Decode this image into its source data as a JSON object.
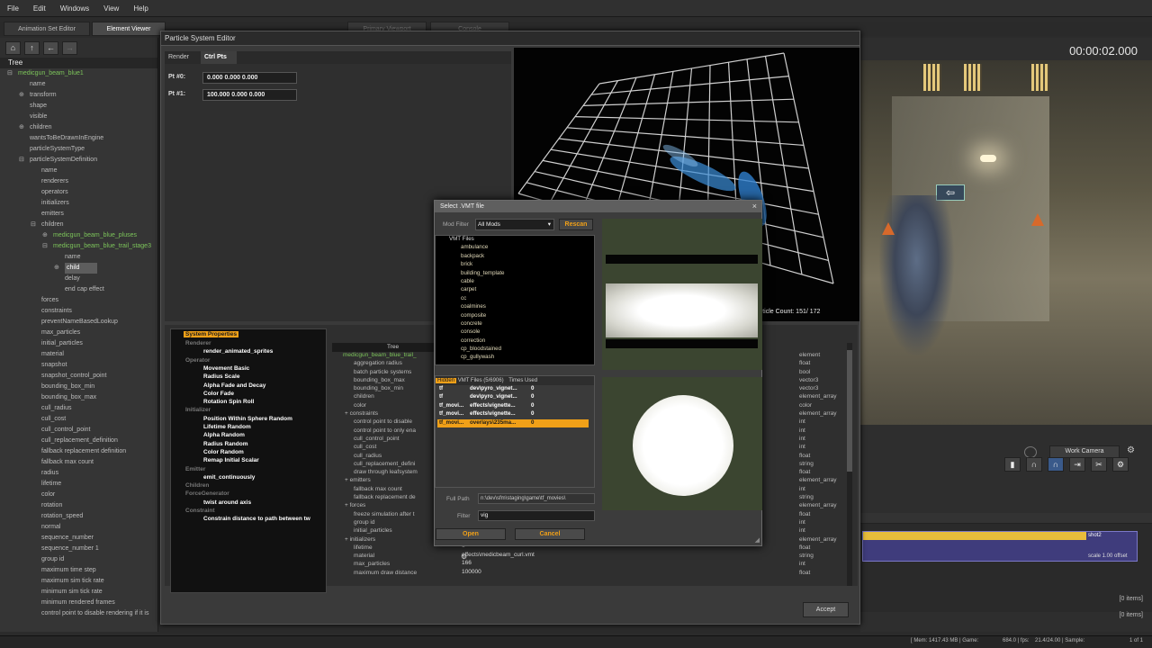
{
  "menu": [
    "File",
    "Edit",
    "Windows",
    "View",
    "Help"
  ],
  "top_tabs": {
    "animation_set_editor": "Animation Set Editor",
    "element_viewer": "Element Viewer",
    "primary_viewport": "Primary Viewport",
    "console": "Console"
  },
  "tree": {
    "header": "Tree",
    "items": [
      {
        "label": "medicgun_beam_blue1",
        "indent": 0,
        "green": true,
        "exp": "-"
      },
      {
        "label": "name",
        "indent": 1
      },
      {
        "label": "transform",
        "indent": 1,
        "exp": "+"
      },
      {
        "label": "shape",
        "indent": 1
      },
      {
        "label": "visible",
        "indent": 1
      },
      {
        "label": "children",
        "indent": 1,
        "exp": "+"
      },
      {
        "label": "wantsToBeDrawnInEngine",
        "indent": 1
      },
      {
        "label": "particleSystemType",
        "indent": 1
      },
      {
        "label": "particleSystemDefinition",
        "indent": 1,
        "exp": "-"
      },
      {
        "label": "name",
        "indent": 2
      },
      {
        "label": "renderers",
        "indent": 2
      },
      {
        "label": "operators",
        "indent": 2
      },
      {
        "label": "initializers",
        "indent": 2
      },
      {
        "label": "emitters",
        "indent": 2
      },
      {
        "label": "children",
        "indent": 2,
        "exp": "-"
      },
      {
        "label": "medicgun_beam_blue_pluses",
        "indent": 3,
        "green": true,
        "exp": "+"
      },
      {
        "label": "medicgun_beam_blue_trail_stage3",
        "indent": 3,
        "green": true,
        "exp": "-"
      },
      {
        "label": "name",
        "indent": 4
      },
      {
        "label": "child",
        "indent": 4,
        "sel": true,
        "exp": "+"
      },
      {
        "label": "delay",
        "indent": 4
      },
      {
        "label": "end cap effect",
        "indent": 4
      },
      {
        "label": "forces",
        "indent": 2
      },
      {
        "label": "constraints",
        "indent": 2
      },
      {
        "label": "preventNameBasedLookup",
        "indent": 2
      },
      {
        "label": "max_particles",
        "indent": 2
      },
      {
        "label": "initial_particles",
        "indent": 2
      },
      {
        "label": "material",
        "indent": 2
      },
      {
        "label": "snapshot",
        "indent": 2
      },
      {
        "label": "snapshot_control_point",
        "indent": 2
      },
      {
        "label": "bounding_box_min",
        "indent": 2
      },
      {
        "label": "bounding_box_max",
        "indent": 2
      },
      {
        "label": "cull_radius",
        "indent": 2
      },
      {
        "label": "cull_cost",
        "indent": 2
      },
      {
        "label": "cull_control_point",
        "indent": 2
      },
      {
        "label": "cull_replacement_definition",
        "indent": 2
      },
      {
        "label": "fallback replacement definition",
        "indent": 2
      },
      {
        "label": "fallback max count",
        "indent": 2
      },
      {
        "label": "radius",
        "indent": 2
      },
      {
        "label": "lifetime",
        "indent": 2
      },
      {
        "label": "color",
        "indent": 2
      },
      {
        "label": "rotation",
        "indent": 2
      },
      {
        "label": "rotation_speed",
        "indent": 2
      },
      {
        "label": "normal",
        "indent": 2
      },
      {
        "label": "sequence_number",
        "indent": 2
      },
      {
        "label": "sequence_number 1",
        "indent": 2
      },
      {
        "label": "group id",
        "indent": 2
      },
      {
        "label": "maximum time step",
        "indent": 2
      },
      {
        "label": "maximum sim tick rate",
        "indent": 2
      },
      {
        "label": "minimum sim tick rate",
        "indent": 2
      },
      {
        "label": "minimum rendered frames",
        "indent": 2
      },
      {
        "label": "control point to disable rendering if it is",
        "indent": 2
      }
    ]
  },
  "particle_editor": {
    "title": "Particle System Editor",
    "tab_render": "Render",
    "tab_ctrl": "Ctrl Pts",
    "pt0_label": "Pt #0:",
    "pt0_value": "0.000 0.000 0.000",
    "pt1_label": "Pt #1:",
    "pt1_value": "100.000 0.000 0.000",
    "particle_count": "article Count:  151/  172",
    "accept": "Accept"
  },
  "system_props": {
    "title": "System Properties",
    "entries": [
      {
        "t": "Renderer",
        "k": "h",
        "x": 10
      },
      {
        "t": "render_animated_sprites",
        "k": "w",
        "x": 30
      },
      {
        "t": "Operator",
        "k": "h",
        "x": 10
      },
      {
        "t": "Movement Basic",
        "k": "w",
        "x": 30
      },
      {
        "t": "Radius Scale",
        "k": "w",
        "x": 30
      },
      {
        "t": "Alpha Fade and Decay",
        "k": "w",
        "x": 30
      },
      {
        "t": "Color Fade",
        "k": "w",
        "x": 30
      },
      {
        "t": "Rotation Spin Roll",
        "k": "w",
        "x": 30
      },
      {
        "t": "Initializer",
        "k": "h",
        "x": 10
      },
      {
        "t": "Position Within Sphere Random",
        "k": "w",
        "x": 30
      },
      {
        "t": "Lifetime Random",
        "k": "w",
        "x": 30
      },
      {
        "t": "Alpha Random",
        "k": "w",
        "x": 30
      },
      {
        "t": "Radius Random",
        "k": "w",
        "x": 30
      },
      {
        "t": "Color Random",
        "k": "w",
        "x": 30
      },
      {
        "t": "Remap Initial Scalar",
        "k": "w",
        "x": 30
      },
      {
        "t": "Emitter",
        "k": "h",
        "x": 10
      },
      {
        "t": "emit_continuously",
        "k": "w",
        "x": 30
      },
      {
        "t": "Children",
        "k": "h",
        "x": 10
      },
      {
        "t": "ForceGenerator",
        "k": "h",
        "x": 10
      },
      {
        "t": "twist around axis",
        "k": "w",
        "x": 30
      },
      {
        "t": "Constraint",
        "k": "h",
        "x": 10
      },
      {
        "t": "Constrain distance to path between tw",
        "k": "w",
        "x": 30
      }
    ]
  },
  "attr_tree": {
    "header": "Tree",
    "rows": [
      {
        "t": "medicgun_beam_blue_trail_",
        "green": true
      },
      {
        "t": "aggregation radius"
      },
      {
        "t": "batch particle systems"
      },
      {
        "t": "bounding_box_max"
      },
      {
        "t": "bounding_box_min"
      },
      {
        "t": "children"
      },
      {
        "t": "color"
      },
      {
        "t": "constraints",
        "exp": "+"
      },
      {
        "t": "control point to disable"
      },
      {
        "t": "control point to only ena"
      },
      {
        "t": "cull_control_point"
      },
      {
        "t": "cull_cost"
      },
      {
        "t": "cull_radius"
      },
      {
        "t": "cull_replacement_defini"
      },
      {
        "t": "draw through leafsystem"
      },
      {
        "t": "emitters",
        "exp": "+"
      },
      {
        "t": "fallback max count"
      },
      {
        "t": "fallback replacement de"
      },
      {
        "t": "forces",
        "exp": "+"
      },
      {
        "t": "freeze simulation after t"
      },
      {
        "t": "group id"
      },
      {
        "t": "initial_particles"
      },
      {
        "t": "initializers",
        "exp": "+"
      },
      {
        "t": "lifetime"
      },
      {
        "t": "material"
      },
      {
        "t": "max_particles"
      },
      {
        "t": "maximum draw distance"
      }
    ],
    "types": [
      "element",
      "float",
      "bool",
      "vector3",
      "vector3",
      "element_array",
      "color",
      "element_array",
      "int",
      "int",
      "int",
      "int",
      "float",
      "string",
      "float",
      "element_array",
      "int",
      "string",
      "element_array",
      "float",
      "int",
      "int",
      "element_array",
      "float",
      "string",
      "int",
      "float"
    ],
    "values": [
      "1",
      "effects\\medicbeam_curl.vmt",
      "166",
      "100000"
    ]
  },
  "vmt_dialog": {
    "title": "Select .VMT file",
    "mod_filter_label": "Mod Filter",
    "mod_filter_value": "All Mods",
    "rescan": "Rescan",
    "folders": [
      "VMT Files",
      "ambulance",
      "backpack",
      "brick",
      "building_template",
      "cable",
      "carpet",
      "cc",
      "coalmines",
      "composite",
      "concrete",
      "console",
      "correction",
      "cp_bloodstained",
      "cp_gullywash"
    ],
    "file_list_header": "VMT Files (5/6906)",
    "col1": "Hidden",
    "col3": "Times Used",
    "files": [
      {
        "mod": "tf",
        "name": "dev\\pyro_vignet...",
        "used": "0"
      },
      {
        "mod": "tf",
        "name": "dev\\pyro_vignet...",
        "used": "0"
      },
      {
        "mod": "tf_movi...",
        "name": "effects\\vignette...",
        "used": "0"
      },
      {
        "mod": "tf_movi...",
        "name": "effects\\vignette...",
        "used": "0"
      },
      {
        "mod": "tf_movi...",
        "name": "overlays\\235ma...",
        "used": "0",
        "sel": true
      }
    ],
    "full_path_label": "Full Path",
    "full_path": "n:\\dev\\sfm\\staging\\game\\tf_movies\\",
    "filter_label": "Filter",
    "filter_value": "vig",
    "open": "Open",
    "cancel": "Cancel"
  },
  "right": {
    "timecode": "00:00:02.000",
    "work_camera": "Work Camera",
    "shot_label": "shot2",
    "scale_label": "scale 1.00 offset",
    "items1": "[0 items]",
    "items2": "[0 items]"
  },
  "status": {
    "mem": "[ Mem: 1417.43 MB | Game:",
    "game": "684.0 | fps:",
    "fps": "21.4/24.00 | Sample:",
    "page": "1 of 1"
  }
}
